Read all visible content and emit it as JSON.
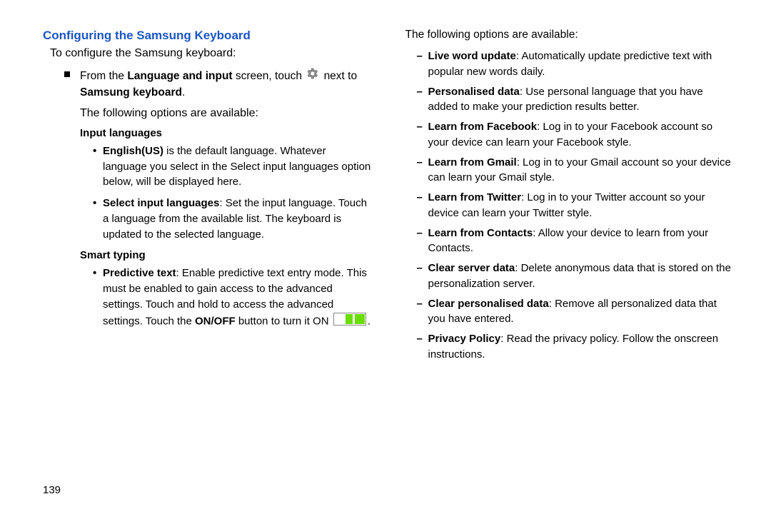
{
  "page_number": "139",
  "left": {
    "heading": "Configuring the Samsung Keyboard",
    "intro": "To configure the Samsung keyboard:",
    "from_step_1": "From the ",
    "from_step_bold1": "Language and input",
    "from_step_2": " screen, touch ",
    "from_step_3": " next to ",
    "from_step_bold2": "Samsung keyboard",
    "from_step_4": ".",
    "options_avail": "The following options are available:",
    "sub1": "Input languages",
    "sub1_items": [
      {
        "bold": "English(US)",
        "rest": " is the default language. Whatever language you select in the Select input languages option below, will be displayed here."
      },
      {
        "bold": "Select input languages",
        "rest": ": Set the input language. Touch a language from the available list. The keyboard is updated to the selected language."
      }
    ],
    "sub2": "Smart typing",
    "sub2_item_bold": "Predictive text",
    "sub2_item_rest1": ": Enable predictive text entry mode. This must be enabled to gain access to the advanced settings. Touch and hold to access the advanced settings. Touch the ",
    "sub2_item_bold2": "ON/OFF",
    "sub2_item_rest2": " button to turn it ON ",
    "sub2_item_rest3": "."
  },
  "right": {
    "options_avail": "The following options are available:",
    "items": [
      {
        "bold": "Live word update",
        "rest": ": Automatically update predictive text with popular new words daily."
      },
      {
        "bold": "Personalised data",
        "rest": ": Use personal language that you have added to make your prediction results better."
      },
      {
        "bold": "Learn from Facebook",
        "rest": ": Log in to your Facebook account so your device can learn your Facebook style."
      },
      {
        "bold": "Learn from Gmail",
        "rest": ": Log in to your Gmail account so your device can learn your Gmail style."
      },
      {
        "bold": "Learn from Twitter",
        "rest": ": Log in to your Twitter account so your device can learn your Twitter style."
      },
      {
        "bold": "Learn from Contacts",
        "rest": ": Allow your device to learn from your Contacts."
      },
      {
        "bold": "Clear server data",
        "rest": ": Delete anonymous data that is stored on the personalization server."
      },
      {
        "bold": "Clear personalised data",
        "rest": ": Remove all personalized data that you have entered."
      },
      {
        "bold": "Privacy Policy",
        "rest": ": Read the privacy policy. Follow the onscreen instructions."
      }
    ]
  }
}
